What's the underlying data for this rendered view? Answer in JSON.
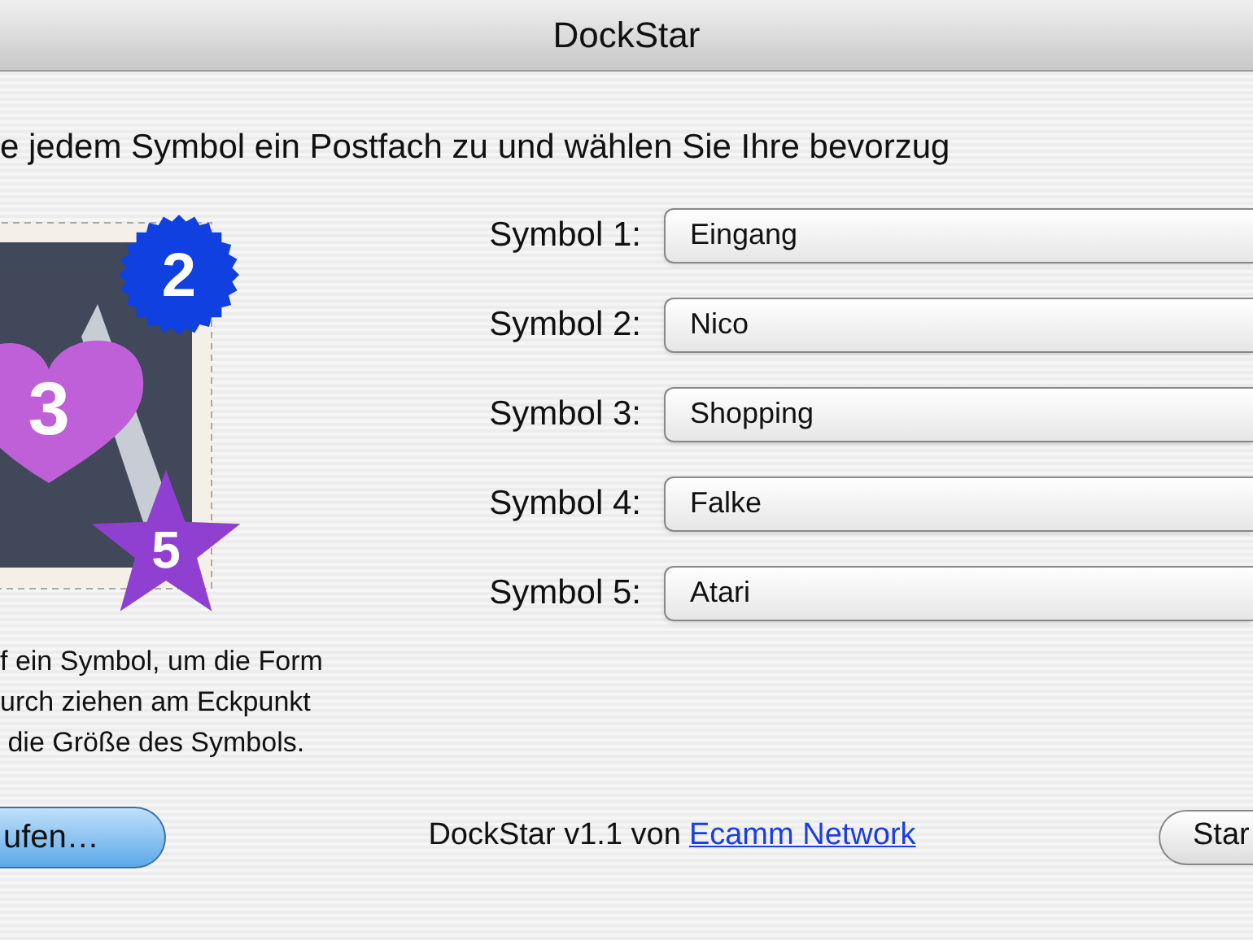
{
  "window": {
    "title": "DockStar"
  },
  "instruction": "e jedem Symbol ein Postfach zu und wählen Sie Ihre bevorzug",
  "badges": [
    {
      "kind": "burst",
      "label": "2",
      "color": "#1040e0"
    },
    {
      "kind": "heart",
      "label": "3",
      "color": "#c060d8"
    },
    {
      "kind": "star",
      "label": "5",
      "color": "#9040d0"
    }
  ],
  "symbols": [
    {
      "label": "Symbol 1:",
      "value": "Eingang"
    },
    {
      "label": "Symbol 2:",
      "value": "Nico"
    },
    {
      "label": "Symbol 3:",
      "value": "Shopping"
    },
    {
      "label": "Symbol 4:",
      "value": "Falke"
    },
    {
      "label": "Symbol 5:",
      "value": "Atari"
    }
  ],
  "hint": [
    "f ein Symbol, um die Form",
    "urch ziehen am Eckpunkt",
    " die Größe des Symbols."
  ],
  "buttons": [
    {
      "label": "ufen…",
      "default": true
    },
    {
      "label": "Star",
      "default": false
    }
  ],
  "footer": {
    "text": "DockStar v1.1 von",
    "link": "Ecamm Network"
  }
}
